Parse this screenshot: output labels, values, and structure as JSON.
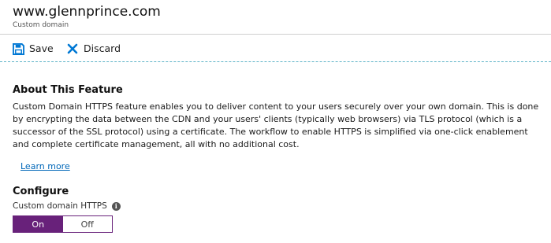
{
  "header": {
    "title": "www.glennprince.com",
    "subtitle": "Custom domain"
  },
  "toolbar": {
    "save_label": "Save",
    "discard_label": "Discard",
    "save_icon": "save-icon",
    "discard_icon": "close-icon",
    "accent_color": "#0078d4"
  },
  "about": {
    "heading": "About This Feature",
    "body": "Custom Domain HTTPS feature enables you to deliver content to your users securely over your own domain. This is done by encrypting the data between the CDN and your users' clients (typically web browsers) via TLS protocol (which is a successor of the SSL protocol) using a certificate. The workflow to enable HTTPS is simplified via one-click enablement and complete certificate management, all with no additional cost.",
    "learn_more": "Learn more"
  },
  "configure": {
    "heading": "Configure",
    "field_label": "Custom domain HTTPS",
    "info_icon": "info-icon",
    "toggle": {
      "on_label": "On",
      "off_label": "Off",
      "selected": "On",
      "selected_color": "#68217a"
    }
  }
}
